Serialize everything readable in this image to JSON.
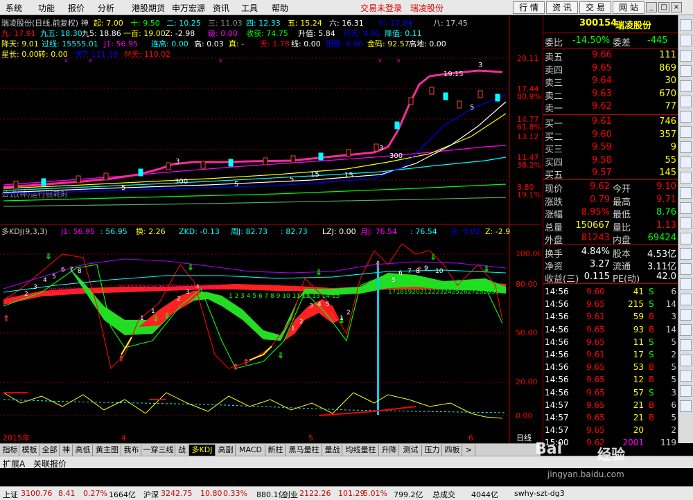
{
  "menu": {
    "items": [
      "系统",
      "功能",
      "报价",
      "分析",
      "港股期货",
      "申万宏源",
      "资讯",
      "工具",
      "帮助"
    ],
    "warning": "交易未登录",
    "stock_name": "瑞凌股份",
    "right_tabs": [
      "行 情",
      "资 讯",
      "交 易",
      "网 站"
    ]
  },
  "chart": {
    "title": "瑞凌股份(日线,前复权) 神",
    "ind_row1": [
      [
        "起: 7.00",
        "#ff0"
      ],
      [
        "十: 9.50",
        "#0f0"
      ],
      [
        "二: 10.25",
        "#0ff"
      ],
      [
        "三: 11.03",
        "#888"
      ],
      [
        "四: 12.33",
        "#0ff"
      ],
      [
        "五: 15.24",
        "#ff0"
      ],
      [
        "六: 16.31",
        "#fff"
      ],
      [
        "七: 17.04",
        "#00f"
      ],
      [
        "八: 17.45",
        "#ccc"
      ]
    ],
    "ind_row2": [
      [
        "九: 17.91",
        "#f00"
      ],
      [
        "九五: 18.30",
        "#0ff"
      ],
      [
        "九5: 18.86",
        "#fff"
      ],
      [
        "一百: 19.00",
        "#ff0"
      ],
      [
        "Z: -2.98",
        "#fff"
      ],
      [
        "级: 0.00",
        "#f0f"
      ],
      [
        "收获: 74.75",
        "#0f0"
      ],
      [
        "升值: 5.84",
        "#fff"
      ],
      [
        "升天: 4.01",
        "#00f"
      ],
      [
        "降值: 0.11",
        "#0ff"
      ]
    ],
    "ind_row3": [
      [
        "降天: 9.01",
        "#ff0"
      ],
      [
        "过线: 15555.01",
        "#0ff"
      ],
      [
        "J1: 56.95",
        "#f0f"
      ],
      [
        "连高: 0.00",
        "#0ff"
      ],
      [
        "高: 0.03",
        "#fff"
      ],
      [
        "真: -",
        "#ff0"
      ],
      [
        "天: 1.78",
        "#f00"
      ],
      [
        "线: 0.00",
        "#fff"
      ],
      [
        "阳数: 0.00",
        "#00f"
      ],
      [
        "金码: 92.57",
        "#ff0"
      ],
      [
        "高地: 0.00",
        "#fff"
      ]
    ],
    "ind_row4": [
      [
        "星长: 0.00",
        "#ff0"
      ],
      [
        "转: 0.00",
        "#ff0"
      ],
      [
        "天T: 111.18",
        "#00f"
      ],
      [
        "M天: 110.02",
        "#f00"
      ]
    ],
    "formula_note": "公式(神)运行很耗时",
    "price_labels": [
      [
        "20.11",
        "#f00"
      ],
      [
        "17.44",
        "#f00"
      ],
      [
        "80.9%",
        "#f00"
      ],
      [
        "14.77",
        "#f00"
      ],
      [
        "61.8%",
        "#f00"
      ],
      [
        "13.12",
        "#f00"
      ],
      [
        "11.47",
        "#f00"
      ],
      [
        "38.2%",
        "#f00"
      ],
      [
        "8.80",
        "#f00"
      ],
      [
        "19.1%",
        "#f00"
      ]
    ],
    "chart_marks": [
      "19.15",
      "3",
      "5",
      "3",
      "300",
      "5",
      "300",
      "5",
      "15",
      "15",
      "3",
      "5"
    ],
    "kdj_row": [
      [
        "多KDJ(9,3,3)",
        "#ccc"
      ],
      [
        "J1: 56.95",
        "#f0f"
      ],
      [
        ": 56.95",
        "#0ff"
      ],
      [
        "换: 2.26",
        "#ff0"
      ],
      [
        "ZKD: -0.13",
        "#0ff"
      ],
      [
        "周J: 82.73",
        "#0ff"
      ],
      [
        ": 82.73",
        "#0ff"
      ],
      [
        "LZJ: 0.00",
        "#fff"
      ],
      [
        "月J: 76.54",
        "#f0f"
      ],
      [
        ": 76.54",
        "#0ff"
      ],
      [
        "天: 0.02",
        "#00f"
      ],
      [
        "Z: -2.9",
        "#ff0"
      ]
    ],
    "kdj_axis": [
      "100.00",
      "80.00",
      "50.00",
      "20.00",
      "0.00"
    ],
    "date_axis": [
      "2015年",
      "4",
      "5",
      "6"
    ],
    "period": "日线"
  },
  "quote": {
    "code": "300154",
    "name": "瑞凌股份",
    "weibi_label": "委比",
    "weibi": "-14.50%",
    "weicha_label": "委差",
    "weicha": "-445",
    "asks": [
      [
        "卖五",
        "9.66",
        "111"
      ],
      [
        "卖四",
        "9.65",
        "869"
      ],
      [
        "卖三",
        "9.64",
        "30"
      ],
      [
        "卖二",
        "9.63",
        "670"
      ],
      [
        "卖一",
        "9.62",
        "77"
      ]
    ],
    "bids": [
      [
        "买一",
        "9.61",
        "746"
      ],
      [
        "买二",
        "9.60",
        "357"
      ],
      [
        "买三",
        "9.59",
        "9"
      ],
      [
        "买四",
        "9.58",
        "55"
      ],
      [
        "买五",
        "9.57",
        "145"
      ]
    ],
    "stats": [
      [
        "现价",
        "9.62",
        "今开",
        "9.10"
      ],
      [
        "涨跌",
        "0.79",
        "最高",
        "9.71"
      ],
      [
        "涨幅",
        "8.95%",
        "最低",
        "8.76"
      ],
      [
        "总量",
        "150667",
        "量比",
        "1.13"
      ],
      [
        "外盘",
        "81243",
        "内盘",
        "69424"
      ]
    ],
    "stats2": [
      [
        "换手",
        "4.84%",
        "股本",
        "4.53亿"
      ],
      [
        "净资",
        "3.27",
        "流通",
        "3.11亿"
      ],
      [
        "收益(三)",
        "0.115",
        "PE(动)",
        "42.0"
      ]
    ],
    "ticks": [
      [
        "14:56",
        "9.60",
        "41",
        "S",
        "6"
      ],
      [
        "14:56",
        "9.65",
        "215",
        "S",
        "14"
      ],
      [
        "14:56",
        "9.61",
        "59",
        "B",
        "3"
      ],
      [
        "14:56",
        "9.65",
        "93",
        "B",
        "14"
      ],
      [
        "14:56",
        "9.65",
        "11",
        "S",
        "5"
      ],
      [
        "14:56",
        "9.61",
        "17",
        "S",
        "2"
      ],
      [
        "14:56",
        "9.65",
        "53",
        "B",
        "5"
      ],
      [
        "14:56",
        "9.65",
        "12",
        "B",
        "5"
      ],
      [
        "14:56",
        "9.65",
        "57",
        "S",
        "3"
      ],
      [
        "14:57",
        "9.65",
        "21",
        "B",
        "6"
      ],
      [
        "14:57",
        "9.65",
        "21",
        "B",
        "5"
      ],
      [
        "14:57",
        "9.65",
        "20",
        "",
        "2"
      ],
      [
        "15:00",
        "9.62",
        "2001",
        "",
        "119"
      ]
    ]
  },
  "tabs": [
    "指标",
    "模板",
    "全部",
    "神",
    "高低",
    "黄主图",
    "我布",
    "一穿三线",
    "战",
    "多KDJ",
    "高副",
    "MACD前",
    "新柱",
    "黑马量柱",
    "量战",
    "均线量柱",
    "升降",
    "测试",
    "压力",
    "四板",
    ">"
  ],
  "tab_active": "多KDJ",
  "subbar": [
    "扩展A",
    "关联报价"
  ],
  "watermark": [
    "Bai",
    "经验",
    "jingyan.baidu.com"
  ],
  "status": {
    "items": [
      [
        "上证",
        "#000"
      ],
      [
        "3100.76",
        "#c00"
      ],
      [
        "8.41",
        "#c00"
      ],
      [
        "0.27%",
        "#c00"
      ],
      [
        "1664亿",
        "#000"
      ],
      [
        "沪深",
        "#000"
      ],
      [
        "3242.75",
        "#c00"
      ],
      [
        "10.80",
        "#c00"
      ],
      [
        "0.33%",
        "#c00"
      ],
      [
        "880.1亿",
        "#000"
      ],
      [
        "创业",
        "#000"
      ],
      [
        "2122.26",
        "#c00"
      ],
      [
        "101.29",
        "#c00"
      ],
      [
        "5.01%",
        "#c00"
      ],
      [
        "799.2亿",
        "#000"
      ],
      [
        "总成交",
        "#000"
      ],
      [
        "4044亿",
        "#000"
      ],
      [
        "swhy-szt-dg3",
        "#000"
      ]
    ]
  }
}
